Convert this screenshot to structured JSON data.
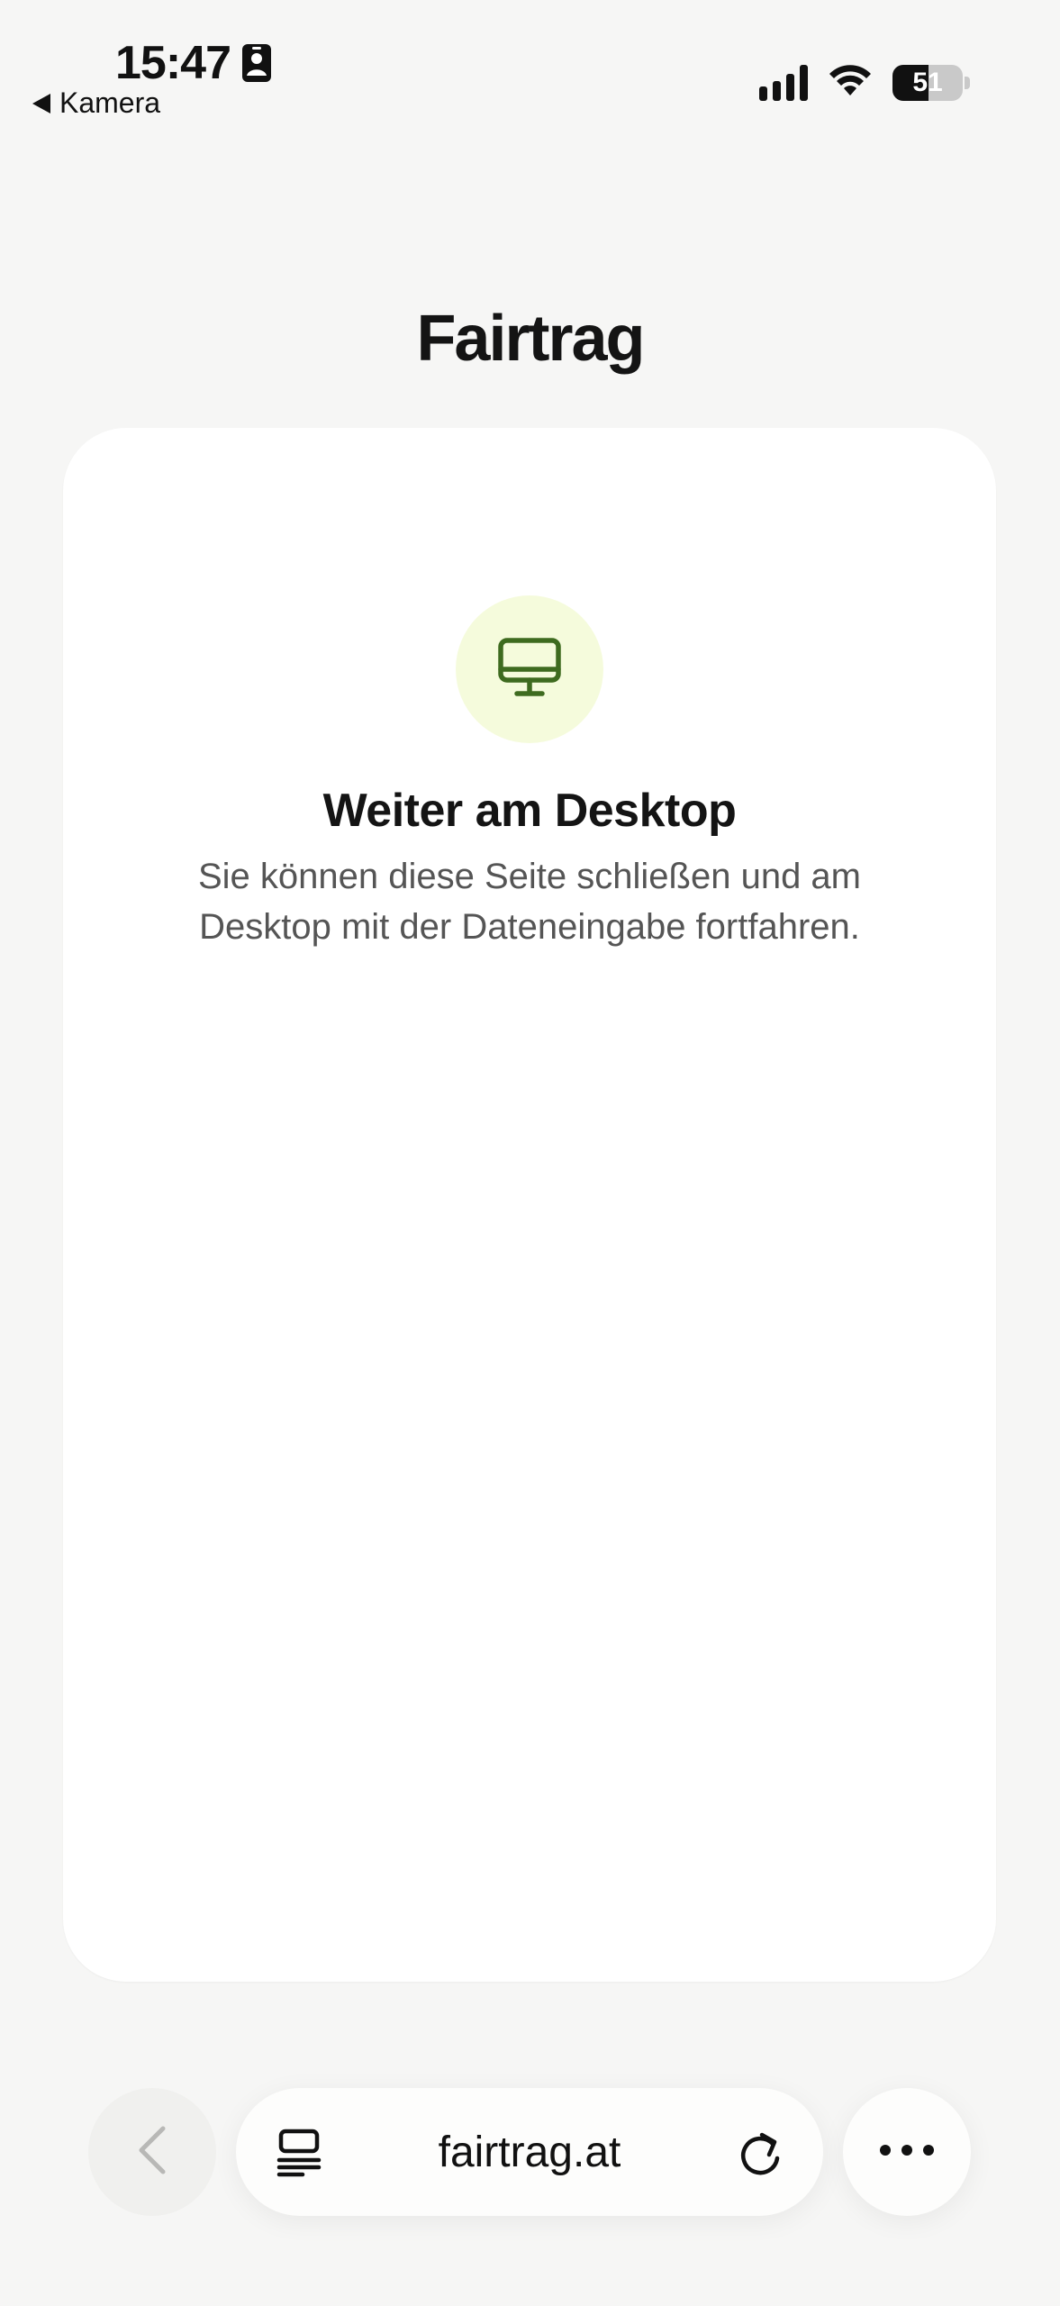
{
  "status_bar": {
    "time": "15:47",
    "back_app": "Kamera",
    "battery": "51",
    "battery_fraction": 0.51
  },
  "brand": {
    "logo": "Fairtrag"
  },
  "card": {
    "icon": "monitor-icon",
    "title": "Weiter am Desktop",
    "description": "Sie können diese Seite schließen und am Desktop mit der Dateneingabe fortfahren."
  },
  "browser_bar": {
    "url": "fairtrag.at",
    "back_icon": "chevron-left-icon",
    "tabs_icon": "tabs-icon",
    "reload_icon": "reload-icon",
    "more_icon": "more-horizontal-icon"
  },
  "colors": {
    "page_bg": "#f6f6f5",
    "card_bg": "#ffffff",
    "icon_circle_bg": "#f5fbdc",
    "icon_green": "#3e6b1f",
    "text_primary": "#141414",
    "text_secondary": "#555555"
  }
}
